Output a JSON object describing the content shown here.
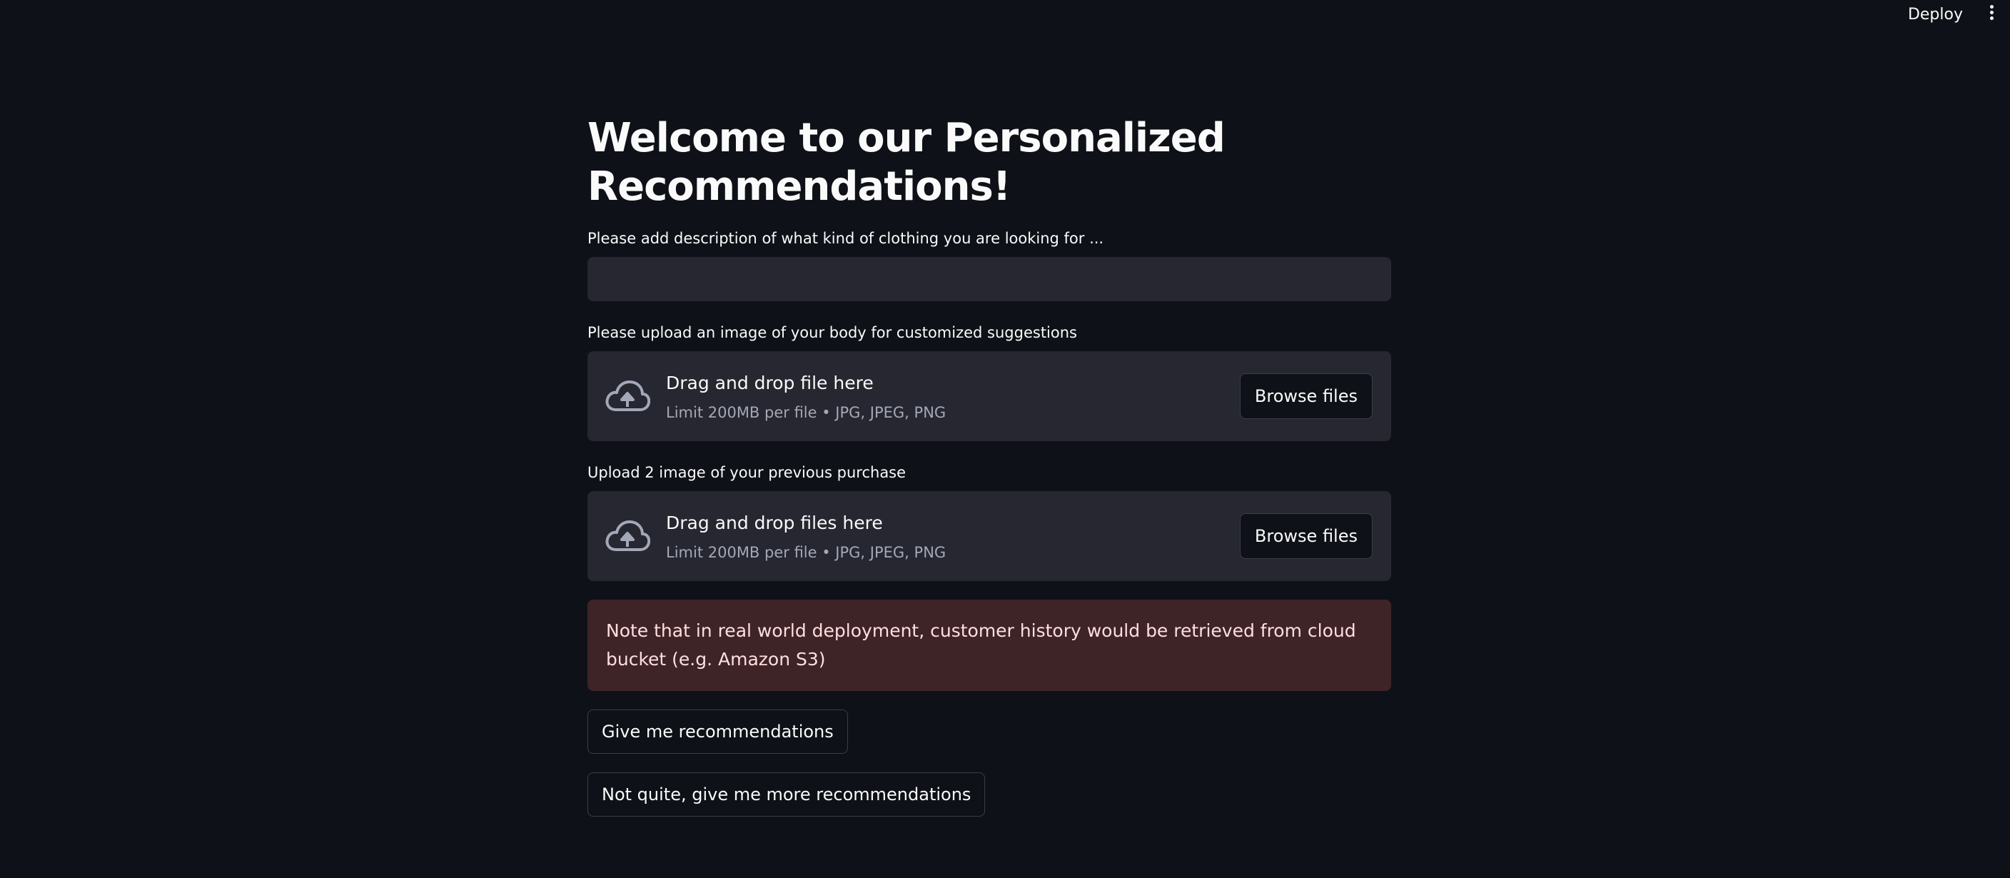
{
  "header": {
    "deploy_label": "Deploy",
    "menu_icon": "kebab-menu-icon"
  },
  "main": {
    "title": "Welcome to our Personalized Recommendations!",
    "description_label": "Please add description of what kind of clothing you are looking for ...",
    "description_value": "",
    "body_upload": {
      "label": "Please upload an image of your body for customized suggestions",
      "title": "Drag and drop file here",
      "subtitle": "Limit 200MB per file • JPG, JPEG, PNG",
      "button": "Browse files",
      "icon": "cloud-upload-icon"
    },
    "purchase_upload": {
      "label": "Upload 2 image of your previous purchase",
      "title": "Drag and drop files here",
      "subtitle": "Limit 200MB per file • JPG, JPEG, PNG",
      "button": "Browse files",
      "icon": "cloud-upload-icon"
    },
    "alert_text": "Note that in real world deployment, customer history would be retrieved from cloud bucket (e.g. Amazon S3)",
    "recommend_button": "Give me recommendations",
    "more_button": "Not quite, give me more recommendations"
  },
  "colors": {
    "background": "#0e1117",
    "input_bg": "#262730",
    "alert_bg": "#3e2427",
    "alert_text": "#ffdedf",
    "muted_text": "#a3a8b8"
  }
}
